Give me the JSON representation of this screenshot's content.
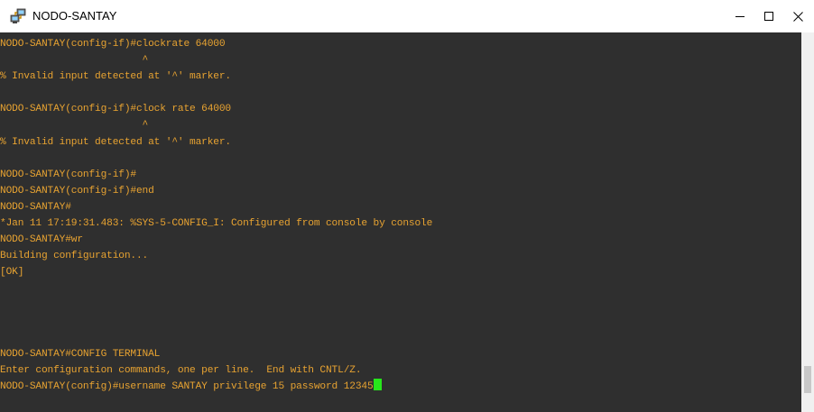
{
  "window": {
    "title": "NODO-SANTAY",
    "app_icon": "network-icon",
    "controls": {
      "minimize": "minimize-icon",
      "maximize": "maximize-icon",
      "close": "close-icon"
    }
  },
  "terminal": {
    "text_color": "#e8a331",
    "background": "#2f2f2f",
    "cursor_color": "#27e61b",
    "lines": [
      "NODO-SANTAY(config-if)#clockrate 64000",
      "                        ^",
      "% Invalid input detected at '^' marker.",
      "",
      "NODO-SANTAY(config-if)#clock rate 64000",
      "                        ^",
      "% Invalid input detected at '^' marker.",
      "",
      "NODO-SANTAY(config-if)#",
      "NODO-SANTAY(config-if)#end",
      "NODO-SANTAY#",
      "*Jan 11 17:19:31.483: %SYS-5-CONFIG_I: Configured from console by console",
      "NODO-SANTAY#wr",
      "Building configuration...",
      "[OK]",
      "",
      "",
      "",
      "",
      "NODO-SANTAY#CONFIG TERMINAL",
      "Enter configuration commands, one per line.  End with CNTL/Z.",
      "NODO-SANTAY(config)#username SANTAY privilege 15 password 12345"
    ]
  }
}
